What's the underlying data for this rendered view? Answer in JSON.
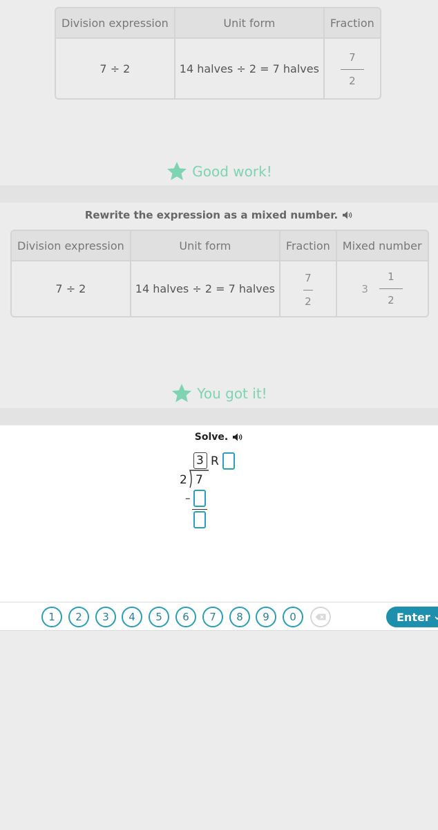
{
  "table1": {
    "headers": [
      "Division expression",
      "Unit form",
      "Fraction"
    ],
    "row": {
      "division": "7 ÷ 2",
      "unit_form": "14 halves ÷ 2 = 7 halves",
      "frac_num": "7",
      "frac_den": "2"
    }
  },
  "feedback1": "Good work!",
  "question2": {
    "prompt": "Rewrite the expression as a mixed number."
  },
  "table2": {
    "headers": [
      "Division expression",
      "Unit form",
      "Fraction",
      "Mixed number"
    ],
    "row": {
      "division": "7 ÷ 2",
      "unit_form": "14 halves ÷ 2 = 7 halves",
      "frac_num": "7",
      "frac_den": "2",
      "mixed_whole": "3",
      "mixed_num": "1",
      "mixed_den": "2"
    }
  },
  "feedback2": "You got it!",
  "problem": {
    "prompt": "Solve.",
    "quotient": "3",
    "remainder_label": "R",
    "divisor": "2",
    "dividend": "7",
    "minus": "–"
  },
  "keypad": {
    "keys": [
      "1",
      "2",
      "3",
      "4",
      "5",
      "6",
      "7",
      "8",
      "9",
      "0"
    ],
    "enter_label": "Enter"
  },
  "colors": {
    "accent": "#2a9fbb",
    "success": "#7ed3b2",
    "enter_bg": "#1f8fae"
  }
}
